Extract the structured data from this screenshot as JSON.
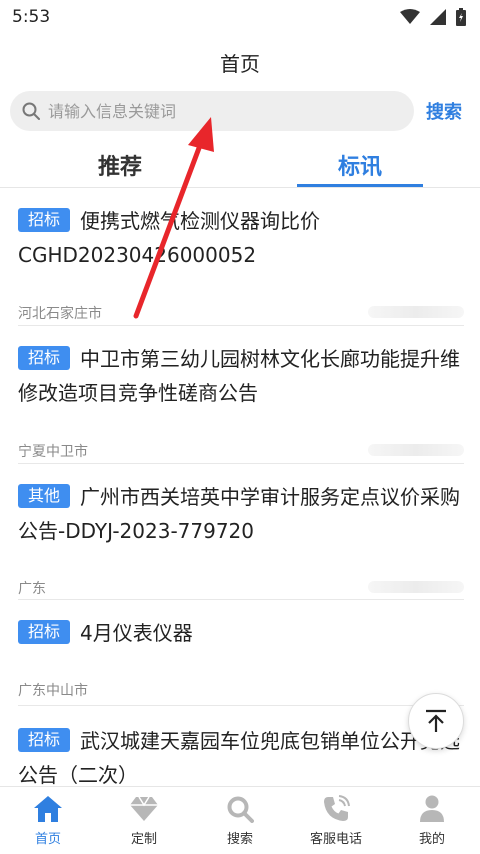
{
  "status_bar": {
    "time": "5:53"
  },
  "header": {
    "title": "首页"
  },
  "search": {
    "placeholder": "请输入信息关键词",
    "button_label": "搜索"
  },
  "tabs": [
    {
      "label": "推荐",
      "active": false
    },
    {
      "label": "标讯",
      "active": true
    }
  ],
  "list": [
    {
      "tag": "招标",
      "title": "便携式燃气检测仪器询比价CGHD20230426000052",
      "region": "河北石家庄市"
    },
    {
      "tag": "招标",
      "title": "中卫市第三幼儿园树林文化长廊功能提升维修改造项目竞争性磋商公告",
      "region": "宁夏中卫市"
    },
    {
      "tag": "其他",
      "title": "广州市西关培英中学审计服务定点议价采购公告-DDYJ-2023-779720",
      "region": "广东"
    },
    {
      "tag": "招标",
      "title": "4月仪表仪器",
      "region": "广东中山市"
    },
    {
      "tag": "招标",
      "title": "武汉城建天嘉园车位兜底包销单位公开竞选公告（二次）",
      "region": ""
    }
  ],
  "bottom_nav": [
    {
      "label": "首页",
      "icon": "home-icon",
      "active": true
    },
    {
      "label": "定制",
      "icon": "diamond-icon",
      "active": false
    },
    {
      "label": "搜索",
      "icon": "search-icon",
      "active": false
    },
    {
      "label": "客服电话",
      "icon": "phone-icon",
      "active": false
    },
    {
      "label": "我的",
      "icon": "user-icon",
      "active": false
    }
  ],
  "colors": {
    "accent": "#2f7fe0",
    "tag": "#3f8ef0",
    "annotation": "#e8262b"
  }
}
